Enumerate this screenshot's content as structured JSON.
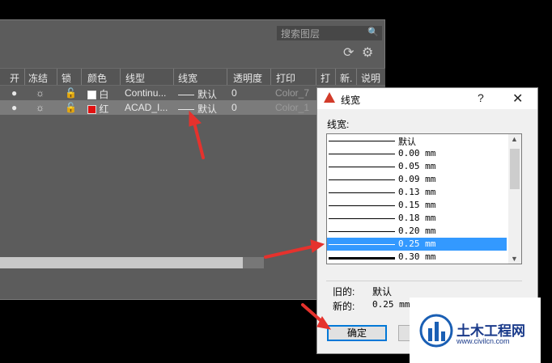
{
  "panel": {
    "search_placeholder": "搜索图层",
    "headers": [
      "开",
      "冻结",
      "锁",
      "颜色",
      "线型",
      "线宽",
      "透明度",
      "打印",
      "打",
      "新.",
      "说明"
    ],
    "rows": [
      {
        "color_name": "白",
        "color_hex": "#ffffff",
        "linetype": "Continu...",
        "lineweight": "默认",
        "transparency": "0",
        "plot_style": "Color_7"
      },
      {
        "color_name": "红",
        "color_hex": "#e01010",
        "linetype": "ACAD_I...",
        "lineweight": "默认",
        "transparency": "0",
        "plot_style": "Color_1"
      }
    ]
  },
  "dialog": {
    "title": "线宽",
    "help": "?",
    "close": "✕",
    "label": "线宽:",
    "items": [
      {
        "text": "默认",
        "weight": 1
      },
      {
        "text": "0.00 mm",
        "weight": 1
      },
      {
        "text": "0.05 mm",
        "weight": 1
      },
      {
        "text": "0.09 mm",
        "weight": 1
      },
      {
        "text": "0.13 mm",
        "weight": 1
      },
      {
        "text": "0.15 mm",
        "weight": 1
      },
      {
        "text": "0.18 mm",
        "weight": 1
      },
      {
        "text": "0.20 mm",
        "weight": 1
      },
      {
        "text": "0.25 mm",
        "weight": 1
      },
      {
        "text": "0.30 mm",
        "weight": 2
      }
    ],
    "selected_index": 8,
    "old_label": "旧的:",
    "old_value": "默认",
    "new_label": "新的:",
    "new_value": "0.25 mm",
    "ok_label": "确定"
  },
  "watermark": {
    "title": "土木工程网",
    "url": "www.civilcn.com"
  },
  "colors": {
    "selection": "#3399ff",
    "arrow": "#e5322d"
  }
}
